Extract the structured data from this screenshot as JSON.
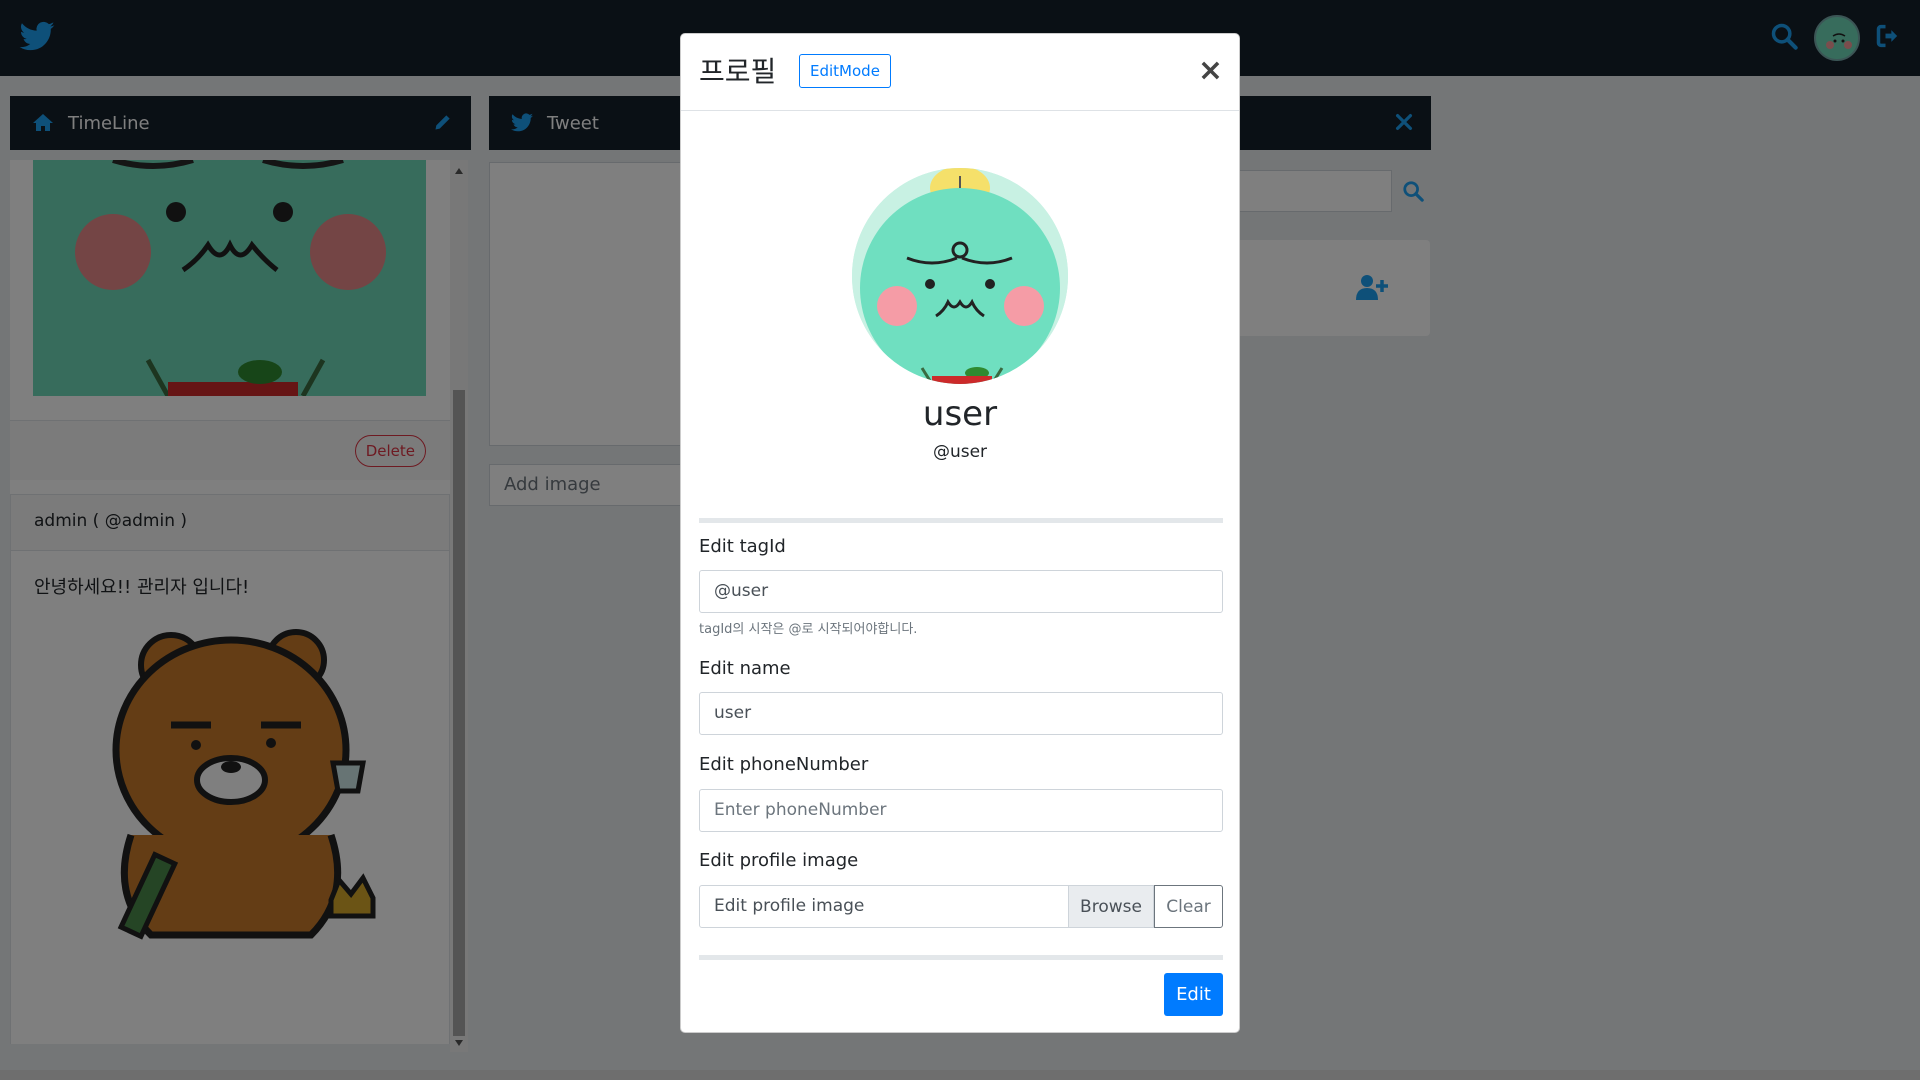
{
  "colors": {
    "nav_bg": "#15202b",
    "accent": "#1da1f2",
    "primary": "#007bff",
    "danger": "#dc3545"
  },
  "icons": {
    "brand": "twitter-bird-icon",
    "search": "search-icon",
    "logout": "sign-out-icon",
    "home": "home-icon",
    "pencil": "pencil-icon",
    "close": "close-icon",
    "add_user": "user-plus-icon"
  },
  "timeline": {
    "header": "TimeLine",
    "card1": {
      "delete_label": "Delete"
    },
    "card2": {
      "author": "admin ( @admin )",
      "text": "안녕하세요!! 관리자 입니다!"
    }
  },
  "tweet": {
    "header": "Tweet",
    "add_image": "Add image"
  },
  "modal": {
    "title": "프로필",
    "editmode_label": "EditMode",
    "close_label": "×",
    "profile": {
      "name": "user",
      "tag": "@user"
    },
    "form": {
      "tagid_label": "Edit tagId",
      "tagid_value": "@user",
      "tagid_help": "tagId의 시작은 @로 시작되어야합니다.",
      "name_label": "Edit name",
      "name_value": "user",
      "phone_label": "Edit phoneNumber",
      "phone_placeholder": "Enter phoneNumber",
      "image_label": "Edit profile image",
      "image_placeholder": "Edit profile image",
      "browse_label": "Browse",
      "clear_label": "Clear",
      "submit_label": "Edit"
    }
  }
}
